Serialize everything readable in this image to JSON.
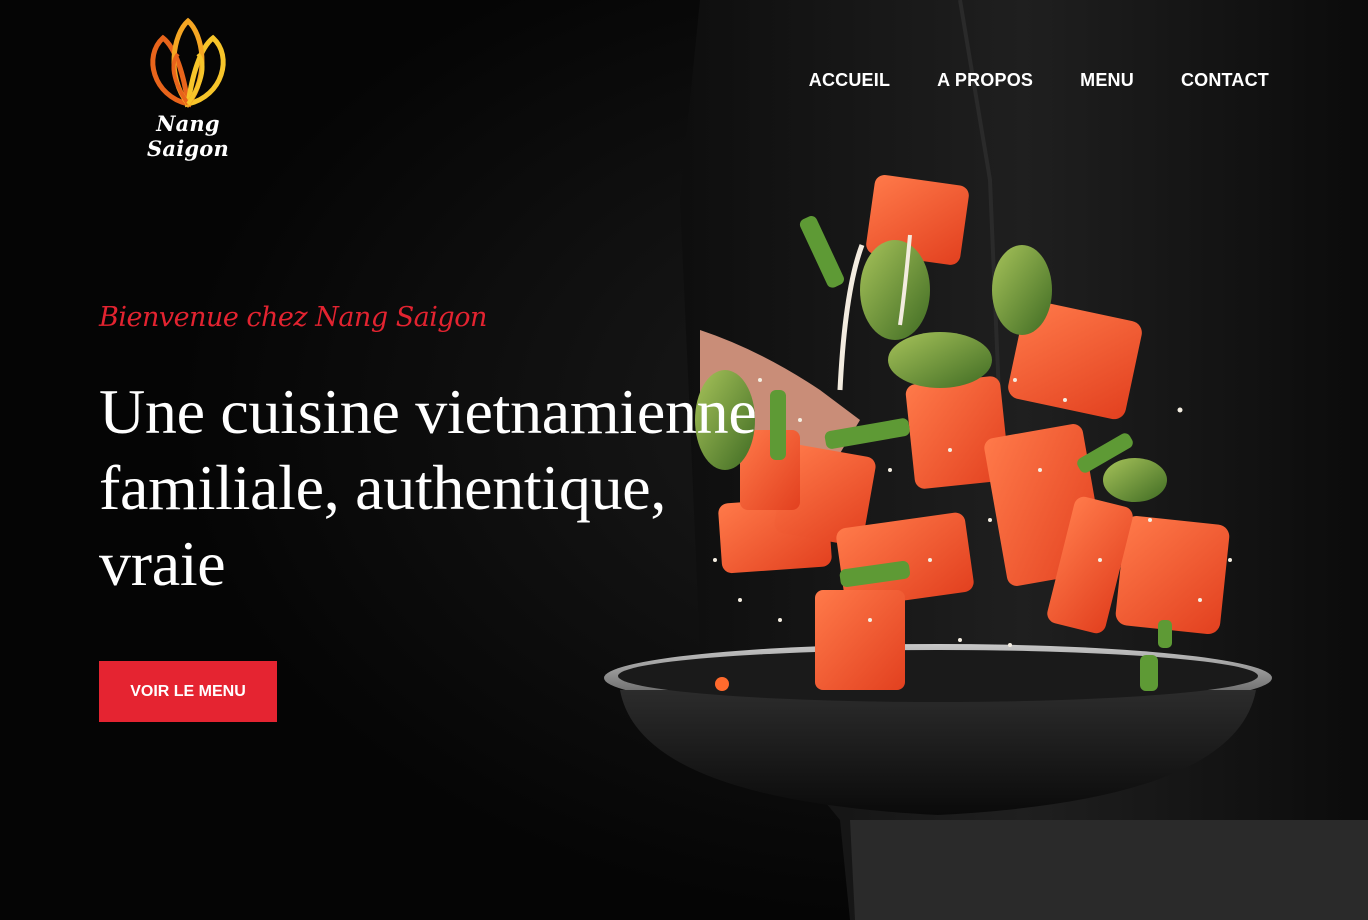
{
  "brand": {
    "name": "Nang Saigon",
    "logo_icon": "lotus-icon",
    "logo_colors": [
      "#e8641b",
      "#f5a623",
      "#f7c52a"
    ]
  },
  "nav": {
    "items": [
      {
        "label": "ACCUEIL"
      },
      {
        "label": "A PROPOS"
      },
      {
        "label": "MENU"
      },
      {
        "label": "CONTACT"
      }
    ]
  },
  "hero": {
    "eyebrow": "Bienvenue chez Nang Saigon",
    "headline_lines": [
      "Une cuisine vietnamienne",
      "familiale, authentique,",
      "vraie"
    ],
    "cta_label": "VOIR LE MENU",
    "image": "chef tossing salmon and green vegetables in a pan"
  },
  "colors": {
    "accent": "#e52431",
    "background": "#050505",
    "text": "#ffffff"
  }
}
